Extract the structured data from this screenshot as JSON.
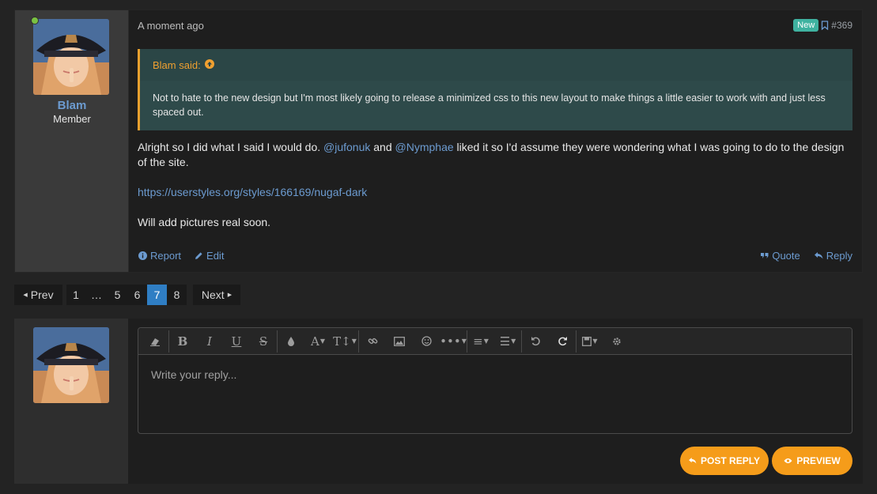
{
  "post": {
    "user": {
      "name": "Blam",
      "title": "Member"
    },
    "date": "A moment ago",
    "badge": "New",
    "number": "#369",
    "quote": {
      "author": "Blam said:",
      "text": "Not to hate to the new design but I'm most likely going to release a minimized css to this new layout to make things a little easier to work with and just less spaced out."
    },
    "body": {
      "p1_a": "Alright so I did what I said I would do. ",
      "mention1": "@jufonuk",
      "p1_b": " and ",
      "mention2": "@Nymphae",
      "p1_c": " liked it so I'd assume they were wondering what I was going to do to the design of the site.",
      "link": "https://userstyles.org/styles/166169/nugaf-dark",
      "p3": "Will add pictures real soon."
    },
    "actions": {
      "report": "Report",
      "edit": "Edit",
      "quote": "Quote",
      "reply": "Reply"
    }
  },
  "pagination": {
    "prev": "Prev",
    "next": "Next",
    "pages": [
      "1",
      "…",
      "5",
      "6",
      "7",
      "8"
    ],
    "current": "7"
  },
  "editor": {
    "placeholder": "Write your reply...",
    "post_reply": "POST REPLY",
    "preview": "PREVIEW"
  },
  "colors": {
    "accent": "#f59c1a",
    "link": "#6c9bd0",
    "current_page": "#2f7ec4",
    "quote_bg": "#2e4a4a",
    "badge": "#3fb2a0"
  }
}
